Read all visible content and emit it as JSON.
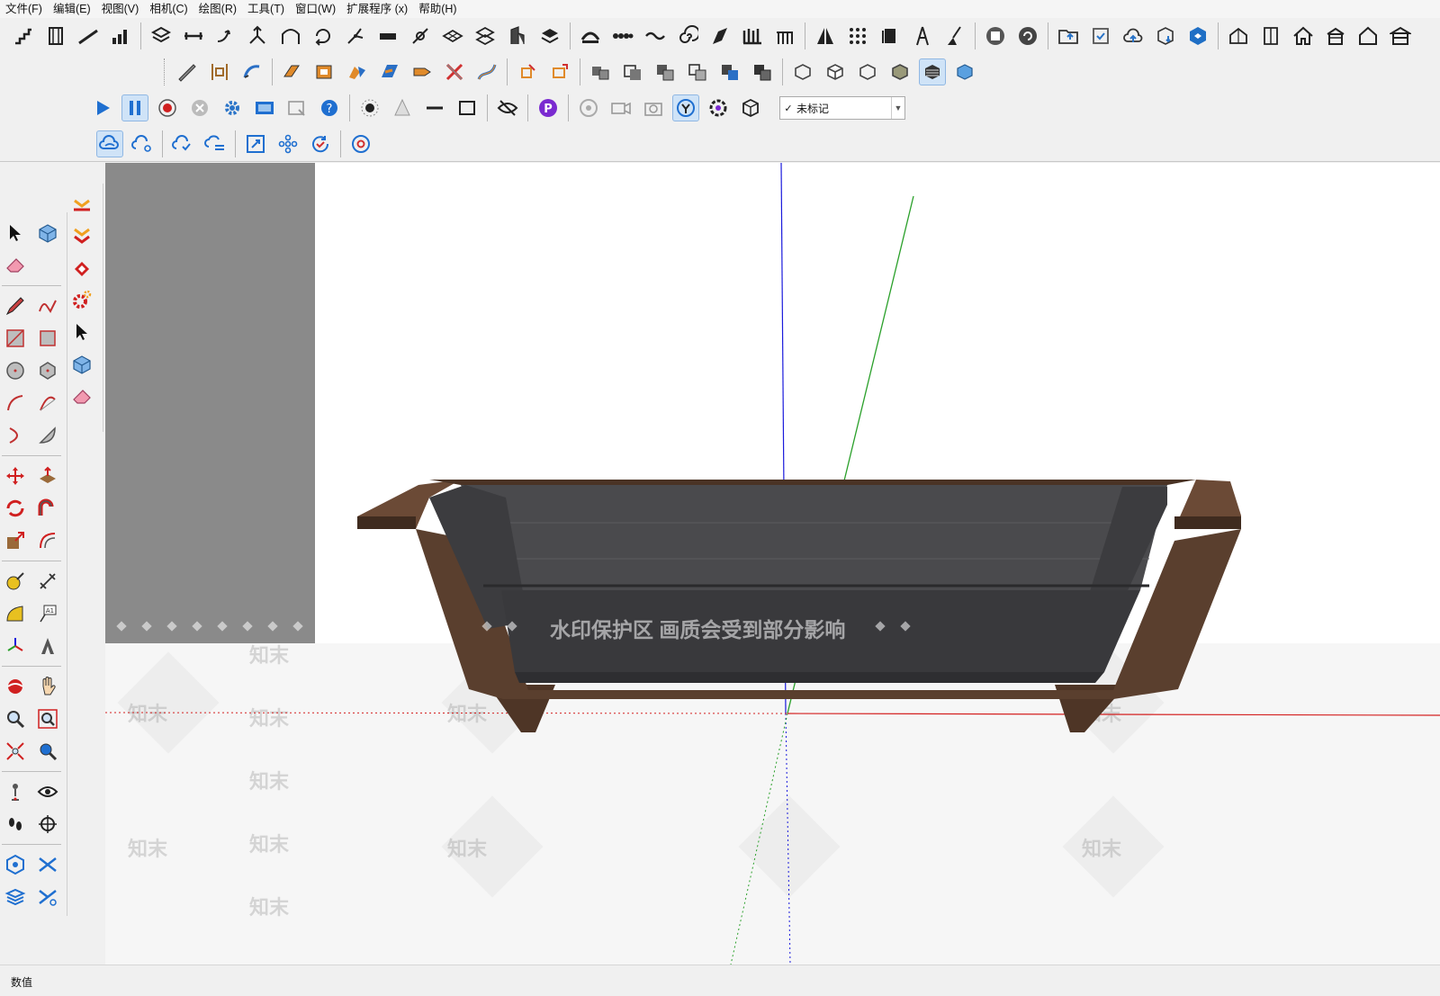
{
  "menu": [
    "文件(F)",
    "编辑(E)",
    "视图(V)",
    "相机(C)",
    "绘图(R)",
    "工具(T)",
    "窗口(W)",
    "扩展程序 (x)",
    "帮助(H)"
  ],
  "toolbar": {
    "tag_selector_value": "未标记",
    "tag_selector_check": "✓"
  },
  "viewport": {
    "watermark_banner": "水印保护区   画质会受到部分影响",
    "watermark_mark": "知末"
  },
  "statusbar": {
    "measurement_label": "数值"
  },
  "colors": {
    "axis_blue": "#1a1adc",
    "axis_green": "#2aa02a",
    "axis_red": "#d42020",
    "sofa_fabric": "#3a3a3c",
    "sofa_wood": "#5a3f2e",
    "active_tool_bg": "#cfe3f7"
  }
}
